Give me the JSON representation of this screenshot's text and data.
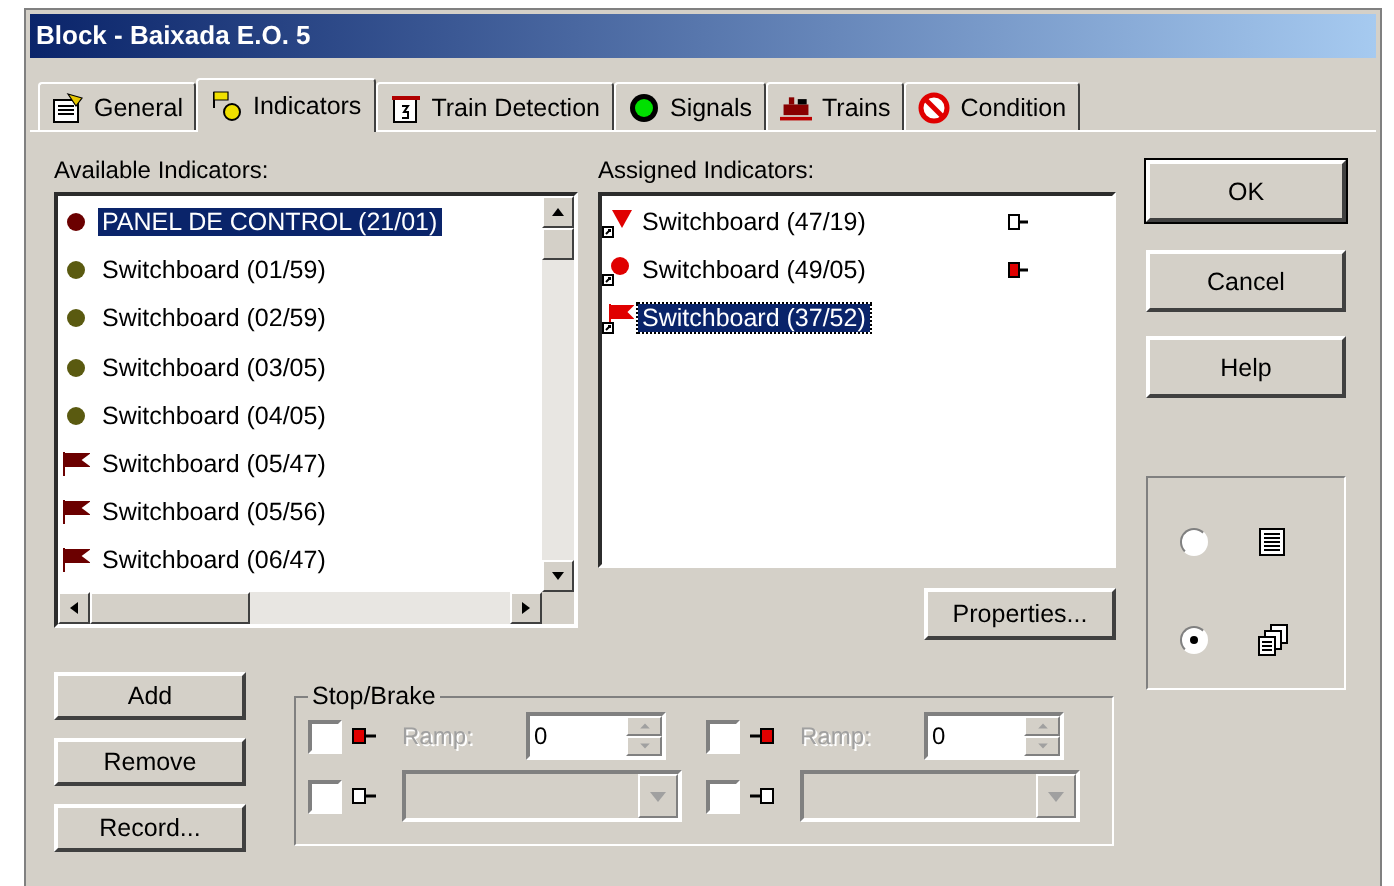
{
  "window": {
    "title": "Block - Baixada E.O. 5"
  },
  "tabs": [
    {
      "label": "General",
      "selected": false
    },
    {
      "label": "Indicators",
      "selected": true
    },
    {
      "label": "Train Detection",
      "selected": false
    },
    {
      "label": "Signals",
      "selected": false
    },
    {
      "label": "Trains",
      "selected": false
    },
    {
      "label": "Condition",
      "selected": false
    }
  ],
  "available": {
    "label": "Available Indicators:",
    "items": [
      {
        "text": "PANEL DE CONTROL (21/01)",
        "kind": "dot",
        "color": "#6b0000",
        "selected": true
      },
      {
        "text": "Switchboard (01/59)",
        "kind": "dot",
        "color": "#5a5a10",
        "selected": false
      },
      {
        "text": "Switchboard (02/59)",
        "kind": "dot",
        "color": "#5a5a10",
        "selected": false
      },
      {
        "text": "Switchboard (03/05)",
        "kind": "dot",
        "color": "#5a5a10",
        "selected": false
      },
      {
        "text": "Switchboard (04/05)",
        "kind": "dot",
        "color": "#5a5a10",
        "selected": false
      },
      {
        "text": "Switchboard (05/47)",
        "kind": "flag",
        "color": "#6b0000",
        "selected": false
      },
      {
        "text": "Switchboard (05/56)",
        "kind": "flag",
        "color": "#6b0000",
        "selected": false
      },
      {
        "text": "Switchboard (06/47)",
        "kind": "flag",
        "color": "#6b0000",
        "selected": false
      }
    ]
  },
  "assigned": {
    "label": "Assigned Indicators:",
    "items": [
      {
        "text": "Switchboard (47/19)",
        "kind": "triangle",
        "brake_indicator": true,
        "brake_active": false,
        "selected": false
      },
      {
        "text": "Switchboard (49/05)",
        "kind": "dot",
        "brake_indicator": true,
        "brake_active": true,
        "selected": false
      },
      {
        "text": "Switchboard (37/52)",
        "kind": "flag",
        "brake_indicator": false,
        "selected": true
      }
    ]
  },
  "properties_button": "Properties...",
  "dialog_buttons": [
    "OK",
    "Cancel",
    "Help"
  ],
  "view_options": [
    {
      "selected": false
    },
    {
      "selected": true
    }
  ],
  "list_buttons": [
    "Add",
    "Remove",
    "Record..."
  ],
  "stop_brake": {
    "title": "Stop/Brake",
    "rows": [
      {
        "kind": "ramp",
        "checked": false,
        "indicator_active": true,
        "disabled": true,
        "label": "Ramp:",
        "value": "0"
      },
      {
        "kind": "ramp",
        "checked": false,
        "indicator_active": true,
        "disabled": true,
        "label": "Ramp:",
        "value": "0"
      },
      {
        "kind": "combo",
        "checked": false,
        "indicator_active": false,
        "disabled": true
      },
      {
        "kind": "combo",
        "checked": false,
        "indicator_active": false,
        "disabled": true
      }
    ]
  }
}
